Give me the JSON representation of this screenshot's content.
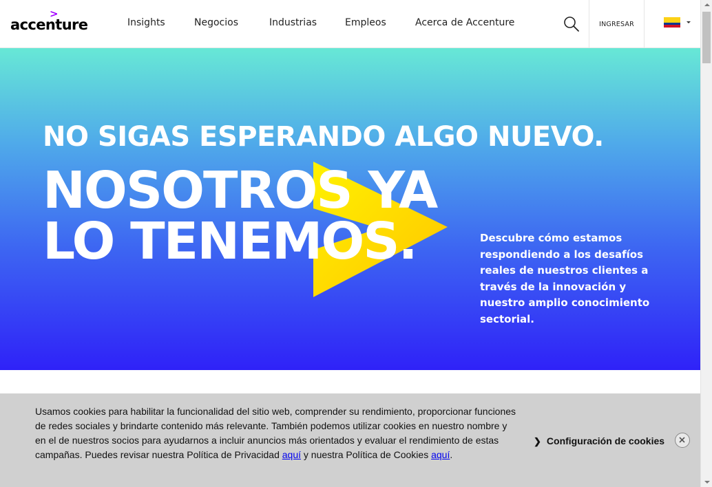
{
  "header": {
    "logo": {
      "text": "accenture",
      "mark": ">"
    },
    "nav": [
      {
        "id": "insights",
        "label": "Insights"
      },
      {
        "id": "negocios",
        "label": "Negocios"
      },
      {
        "id": "industrias",
        "label": "Industrias"
      },
      {
        "id": "empleos",
        "label": "Empleos"
      },
      {
        "id": "acerca",
        "label": "Acerca de Accenture"
      }
    ],
    "search_icon": "search-icon",
    "login_label": "INGRESAR",
    "country": {
      "flag": "colombia-flag-icon",
      "caret": "caret-down-icon"
    }
  },
  "hero": {
    "line1": "NO SIGAS ESPERANDO ALGO NUEVO.",
    "line2": "NOSOTROS YA",
    "line3": "LO TENEMOS.",
    "description": "Descubre cómo estamos respondiendo a los desafíos reales de nuestros clientes a través de la innovación y nuestro amplio conocimiento sectorial.",
    "gradient_colors": [
      "#67e8d6",
      "#4fa9ea",
      "#3d66f2",
      "#2f22f8"
    ],
    "chevron_colors": [
      "#fff200",
      "#ffd200",
      "#ff9f00"
    ]
  },
  "cookie_banner": {
    "text_before_link1": "Usamos cookies para habilitar la funcionalidad del sitio web, comprender su rendimiento, proporcionar funciones de redes sociales y brindarte contenido más relevante. También podemos utilizar cookies en nuestro nombre y en el de nuestros socios para ayudarnos a incluir anuncios más orientados y evaluar el rendimiento de estas campañas. Puedes revisar nuestra Política de Privacidad ",
    "link1": "aquí",
    "text_between": " y nuestra Política de Cookies ",
    "link2": "aquí",
    "text_after": ".",
    "settings_label": "Configuración de cookies",
    "settings_icon": "chevron-right-icon",
    "close_icon": "close-icon"
  },
  "colors": {
    "brand_purple": "#a100ff",
    "banner_bg": "#d0d0d0",
    "link": "#0000ee"
  }
}
